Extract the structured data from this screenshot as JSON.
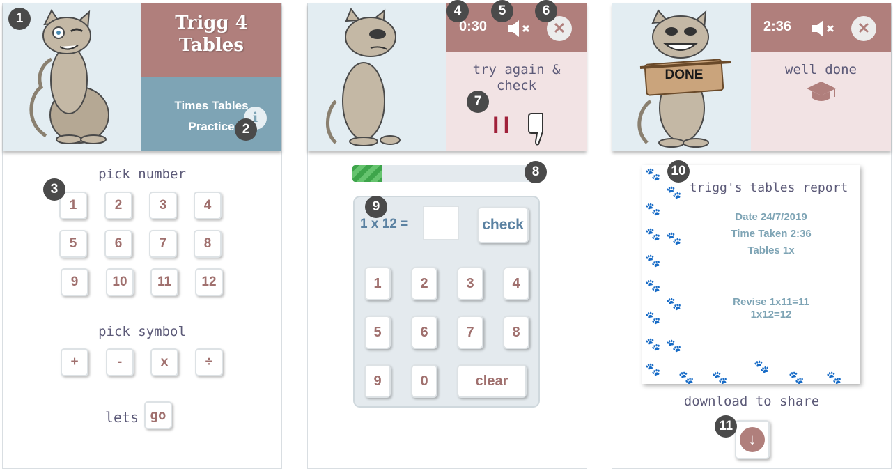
{
  "markers": [
    "1",
    "2",
    "3",
    "4",
    "5",
    "6",
    "7",
    "8",
    "9",
    "10",
    "11"
  ],
  "screen1": {
    "title": "Trigg 4 Tables",
    "subtitle_line1": "Times Tables",
    "subtitle_line2": "Practice",
    "info_icon": "info-icon",
    "pick_number_label": "pick number",
    "numbers": [
      "1",
      "2",
      "3",
      "4",
      "5",
      "6",
      "7",
      "8",
      "9",
      "10",
      "11",
      "12"
    ],
    "pick_symbol_label": "pick symbol",
    "symbols": [
      "+",
      "-",
      "x",
      "÷"
    ],
    "lets_label": "lets",
    "go_label": "go"
  },
  "screen2": {
    "timer": "0:30",
    "mute_icon": "speaker-muted-icon",
    "close_icon": "close-icon",
    "feedback_line1": "try again &",
    "feedback_line2": "check",
    "tally": "II",
    "progress_fraction": 0.16,
    "equation": "1 x 12 =",
    "check_label": "check",
    "keys": [
      "1",
      "2",
      "3",
      "4",
      "5",
      "6",
      "7",
      "8",
      "9",
      "0"
    ],
    "clear_label": "clear"
  },
  "screen3": {
    "timer": "2:36",
    "done_sign": "DONE",
    "feedback": "well done",
    "report_title": "trigg's tables report",
    "date_line": "Date 24/7/2019",
    "time_line": "Time Taken 2:36",
    "tables_line": "Tables 1x",
    "revise_line1": "Revise 1x11=11",
    "revise_line2": "1x12=12",
    "download_label": "download to share"
  },
  "colors": {
    "rose": "#b07f7c",
    "blue": "#7ea4b5",
    "pale": "#e3edf2",
    "pink": "#f2e3e4",
    "green": "#3ea54b"
  }
}
